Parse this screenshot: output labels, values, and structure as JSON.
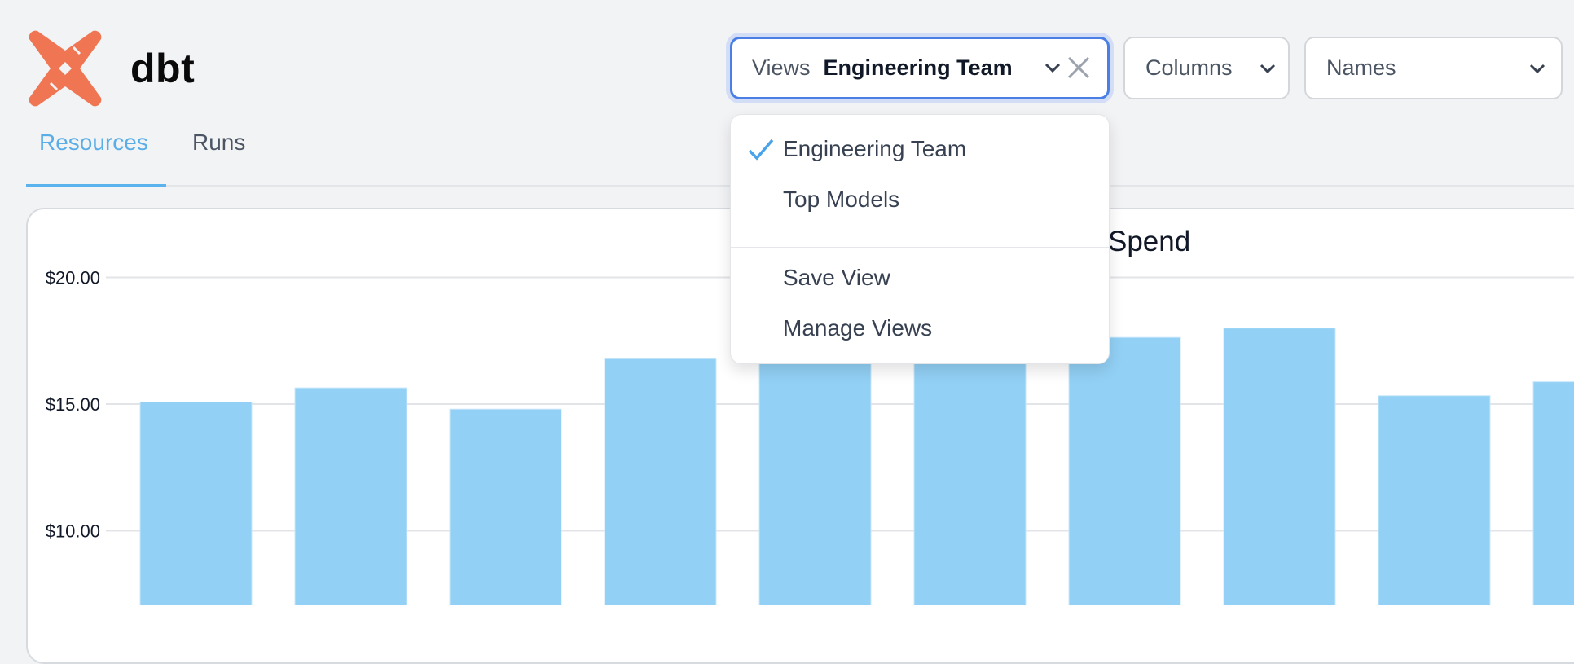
{
  "app": {
    "brand": "dbt",
    "logo_icon": "dbt-logo-icon",
    "brand_color": "#f07653"
  },
  "tabs": [
    {
      "label": "Resources",
      "active": true
    },
    {
      "label": "Runs",
      "active": false
    }
  ],
  "filters": {
    "views": {
      "label": "Views",
      "value": "Engineering Team",
      "open": true
    },
    "columns": {
      "label": "Columns"
    },
    "names": {
      "label": "Names"
    }
  },
  "views_menu": {
    "items": [
      {
        "label": "Engineering Team",
        "selected": true
      },
      {
        "label": "Top Models",
        "selected": false
      }
    ],
    "actions": [
      {
        "label": "Save View"
      },
      {
        "label": "Manage Views"
      }
    ]
  },
  "colors": {
    "accent": "#5ab3ed",
    "focus_border": "#4a7fe6",
    "bar": "#92d0f5",
    "check": "#4aa3e8"
  },
  "chart_data": {
    "type": "bar",
    "title_visible": "Spend",
    "xlabel": "",
    "ylabel": "",
    "y_ticks": [
      "$20.00",
      "$15.00",
      "$10.00"
    ],
    "y_tick_values": [
      20,
      15,
      10
    ],
    "grid": true,
    "bars_visible_count": 10,
    "values": [
      15.08,
      15.64,
      14.8,
      16.79,
      17.2,
      17.4,
      17.63,
      18.0,
      15.33,
      15.88
    ],
    "values_note": "bars 5 and 6 tops hidden behind open dropdown; values estimated (>16.6)",
    "series_color": "#92d0f5"
  }
}
